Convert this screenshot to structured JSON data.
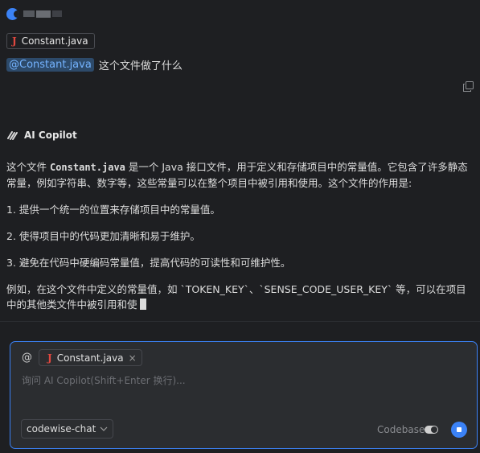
{
  "user_message": {
    "file_chip": {
      "icon": "java-icon",
      "glyph": "J",
      "name": "Constant.java"
    },
    "mention": "@Constant.java",
    "question": "这个文件做了什么"
  },
  "assistant": {
    "name": "AI Copilot",
    "intro_prefix": "这个文件 ",
    "intro_code": "Constant.java",
    "intro_suffix": " 是一个 Java 接口文件，用于定义和存储项目中的常量值。它包含了许多静态常量，例如字符串、数字等，这些常量可以在整个项目中被引用和使用。这个文件的作用是:",
    "points": [
      "1. 提供一个统一的位置来存储项目中的常量值。",
      "2. 使得项目中的代码更加清晰和易于维护。",
      "3. 避免在代码中硬编码常量值，提高代码的可读性和可维护性。"
    ],
    "example": "例如，在这个文件中定义的常量值，如 `TOKEN_KEY`、`SENSE_CODE_USER_KEY` 等，可以在项目中的其他类文件中被引用和使"
  },
  "input": {
    "at_sign": "@",
    "context_chip": {
      "glyph": "J",
      "name": "Constant.java",
      "close": "×"
    },
    "placeholder": "询问 AI Copilot(Shift+Enter 换行)...",
    "model": "codewise-chat",
    "codebase_label": "Codebase",
    "codebase_enabled": false
  },
  "colors": {
    "accent": "#3b82f6",
    "java": "#e0473f",
    "mention_text": "#74b3ff"
  }
}
